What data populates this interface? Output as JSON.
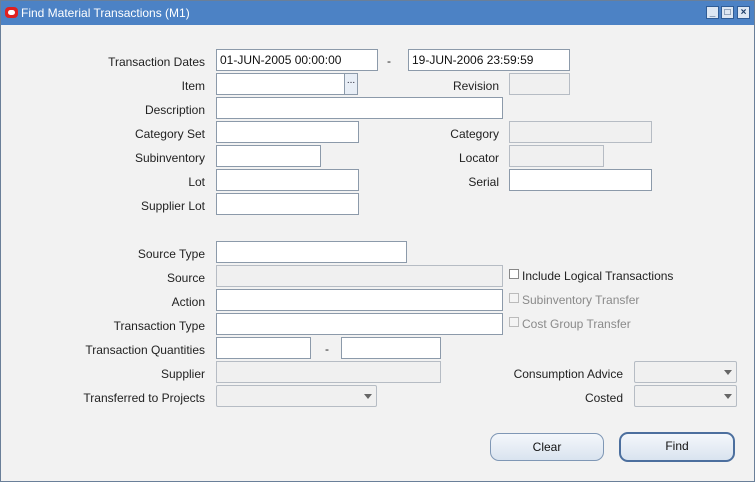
{
  "window": {
    "title": "Find Material Transactions (M1)",
    "controls": [
      "minimize",
      "maximize",
      "close"
    ]
  },
  "labels": {
    "transaction_dates": "Transaction Dates",
    "item": "Item",
    "revision": "Revision",
    "description": "Description",
    "category_set": "Category Set",
    "category": "Category",
    "subinventory": "Subinventory",
    "locator": "Locator",
    "lot": "Lot",
    "serial": "Serial",
    "supplier_lot": "Supplier Lot",
    "source_type": "Source Type",
    "source": "Source",
    "action": "Action",
    "transaction_type": "Transaction Type",
    "transaction_quantities": "Transaction Quantities",
    "supplier": "Supplier",
    "transferred_to_projects": "Transferred to Projects",
    "consumption_advice": "Consumption Advice",
    "costed": "Costed",
    "range_separator": "-"
  },
  "values": {
    "date_from": "01-JUN-2005 00:00:00",
    "date_to": "19-JUN-2006 23:59:59",
    "item": "",
    "revision": "",
    "description": "",
    "category_set": "",
    "category": "",
    "subinventory": "",
    "locator": "",
    "lot": "",
    "serial": "",
    "supplier_lot": "",
    "source_type": "",
    "source": "",
    "action": "",
    "transaction_type": "",
    "qty_from": "",
    "qty_to": "",
    "supplier": "",
    "transferred_to_projects": "",
    "consumption_advice": "",
    "costed": ""
  },
  "checkboxes": {
    "include_logical": {
      "label": "Include Logical Transactions",
      "checked": false,
      "enabled": true
    },
    "subinventory_transfer": {
      "label": "Subinventory Transfer",
      "checked": false,
      "enabled": false
    },
    "cost_group_transfer": {
      "label": "Cost Group Transfer",
      "checked": false,
      "enabled": false
    }
  },
  "buttons": {
    "lov": "...",
    "clear": "Clear",
    "find": "Find"
  },
  "colors": {
    "titlebar": "#4c82c5",
    "background": "#f2f2f2",
    "disabled_text": "#8a8a8a"
  }
}
